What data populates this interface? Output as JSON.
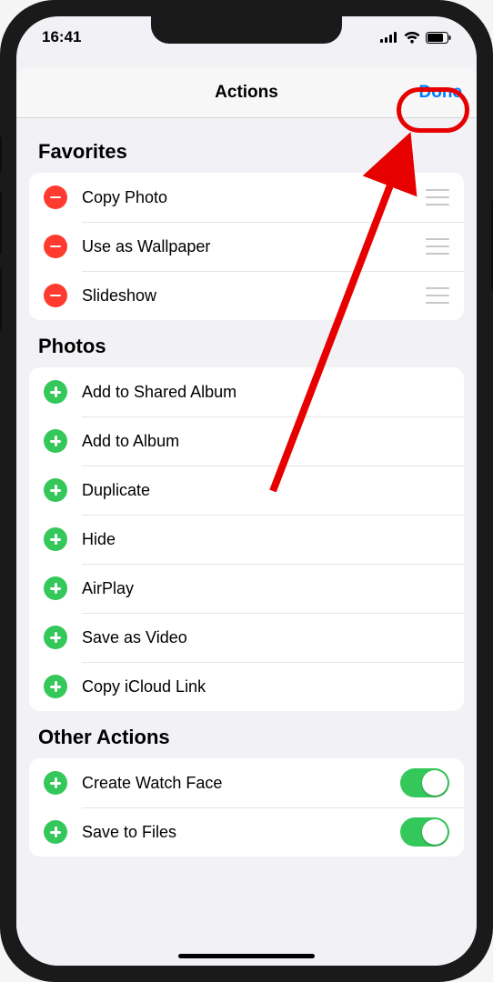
{
  "status": {
    "time": "16:41"
  },
  "nav": {
    "title": "Actions",
    "done": "Done"
  },
  "sections": {
    "favorites": {
      "header": "Favorites",
      "items": [
        {
          "label": "Copy Photo"
        },
        {
          "label": "Use as Wallpaper"
        },
        {
          "label": "Slideshow"
        }
      ]
    },
    "photos": {
      "header": "Photos",
      "items": [
        {
          "label": "Add to Shared Album"
        },
        {
          "label": "Add to Album"
        },
        {
          "label": "Duplicate"
        },
        {
          "label": "Hide"
        },
        {
          "label": "AirPlay"
        },
        {
          "label": "Save as Video"
        },
        {
          "label": "Copy iCloud Link"
        }
      ]
    },
    "other": {
      "header": "Other Actions",
      "items": [
        {
          "label": "Create Watch Face"
        },
        {
          "label": "Save to Files"
        }
      ]
    }
  }
}
